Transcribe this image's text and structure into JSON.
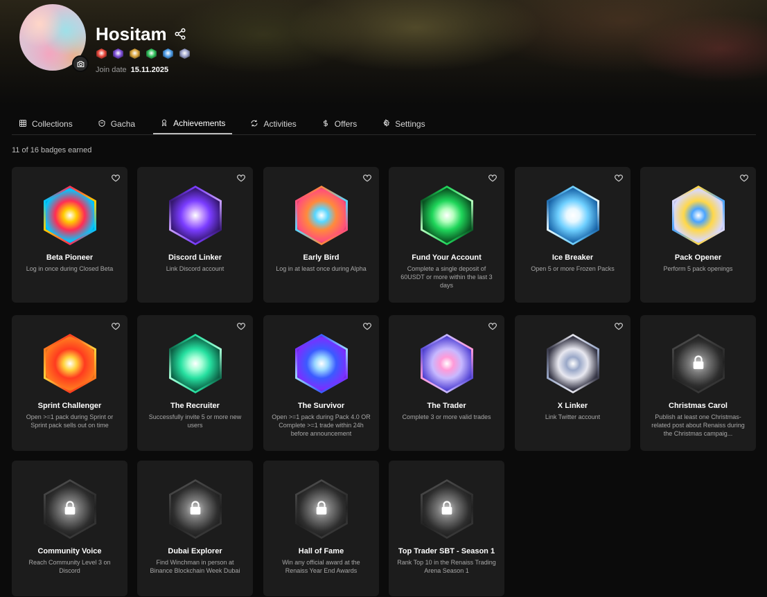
{
  "profile": {
    "username": "Hositam",
    "join_label": "Join date",
    "join_date": "15.11.2025",
    "mini_badge_colors": [
      "#e8463a",
      "#7b4bd6",
      "#d8a33a",
      "#2fbf5a",
      "#4b9be8",
      "#9aa0c8"
    ]
  },
  "tabs": [
    {
      "label": "Collections",
      "icon": "grid-icon",
      "active": false
    },
    {
      "label": "Gacha",
      "icon": "gacha-icon",
      "active": false
    },
    {
      "label": "Achievements",
      "icon": "award-icon",
      "active": true
    },
    {
      "label": "Activities",
      "icon": "refresh-icon",
      "active": false
    },
    {
      "label": "Offers",
      "icon": "dollar-icon",
      "active": false
    },
    {
      "label": "Settings",
      "icon": "gear-icon",
      "active": false
    }
  ],
  "summary": "11 of 16 badges earned",
  "badges": [
    {
      "title": "Beta Pioneer",
      "desc": "Log in once during Closed Beta",
      "earned": true,
      "colors": [
        "#ff2d55",
        "#ffcc00",
        "#00c8ff"
      ]
    },
    {
      "title": "Discord Linker",
      "desc": "Link Discord account",
      "earned": true,
      "colors": [
        "#7a3cff",
        "#c9a0ff",
        "#3a1a7a"
      ]
    },
    {
      "title": "Early Bird",
      "desc": "Log in at least once during Alpha",
      "earned": true,
      "colors": [
        "#ff8a3c",
        "#58d6ff",
        "#ff4f7b"
      ]
    },
    {
      "title": "Fund Your Account",
      "desc": "Complete a single deposit of 60USDT or more within the last 3 days",
      "earned": true,
      "colors": [
        "#1fd65a",
        "#b6ffbf",
        "#0b5a25"
      ]
    },
    {
      "title": "Ice Breaker",
      "desc": "Open 5 or more Frozen Packs",
      "earned": true,
      "colors": [
        "#6fd0ff",
        "#e8f8ff",
        "#1f6db0"
      ]
    },
    {
      "title": "Pack Opener",
      "desc": "Perform 5 pack openings",
      "earned": true,
      "colors": [
        "#ffd84a",
        "#4aa4ff",
        "#d9d9ff"
      ]
    },
    {
      "title": "Sprint Challenger",
      "desc": "Open >=1 pack during Sprint or Sprint pack sells out on time",
      "earned": true,
      "colors": [
        "#ff3b1f",
        "#ffd23c",
        "#ff7a1f"
      ]
    },
    {
      "title": "The Recruiter",
      "desc": "Successfully invite 5 or more new users",
      "earned": true,
      "colors": [
        "#26e0a0",
        "#a8ffd8",
        "#0e6a4c"
      ]
    },
    {
      "title": "The Survivor",
      "desc": "Open >=1 pack during Pack 4.0 OR Complete >=1 trade within 24h before announcement",
      "earned": true,
      "colors": [
        "#3b5bff",
        "#9ad8ff",
        "#7b2fff"
      ]
    },
    {
      "title": "The Trader",
      "desc": "Complete 3 or more valid trades",
      "earned": true,
      "colors": [
        "#c7b8ff",
        "#ff9ad8",
        "#5a4bd8"
      ]
    },
    {
      "title": "X Linker",
      "desc": "Link Twitter account",
      "earned": true,
      "colors": [
        "#e8e8f0",
        "#9aa8c8",
        "#3a3a4a"
      ]
    },
    {
      "title": "Christmas Carol",
      "desc": "Publish at least one Christmas-related post about Renaiss during the Christmas campaig...",
      "earned": false,
      "colors": [
        "#9a9a9a",
        "#e0e0e0",
        "#3a3a3a"
      ]
    },
    {
      "title": "Community Voice",
      "desc": "Reach Community Level 3 on Discord",
      "earned": false,
      "colors": [
        "#9a9a9a",
        "#e0e0e0",
        "#3a3a3a"
      ]
    },
    {
      "title": "Dubai Explorer",
      "desc": "Find Winchman in person at Binance Blockchain Week Dubai",
      "earned": false,
      "colors": [
        "#9a9a9a",
        "#e0e0e0",
        "#3a3a3a"
      ]
    },
    {
      "title": "Hall of Fame",
      "desc": "Win any official award at the Renaiss Year End Awards",
      "earned": false,
      "colors": [
        "#9a9a9a",
        "#e0e0e0",
        "#3a3a3a"
      ]
    },
    {
      "title": "Top Trader SBT - Season 1",
      "desc": "Rank Top 10 in the Renaiss Trading Arena Season 1",
      "earned": false,
      "colors": [
        "#9a9a9a",
        "#e0e0e0",
        "#3a3a3a"
      ]
    }
  ]
}
